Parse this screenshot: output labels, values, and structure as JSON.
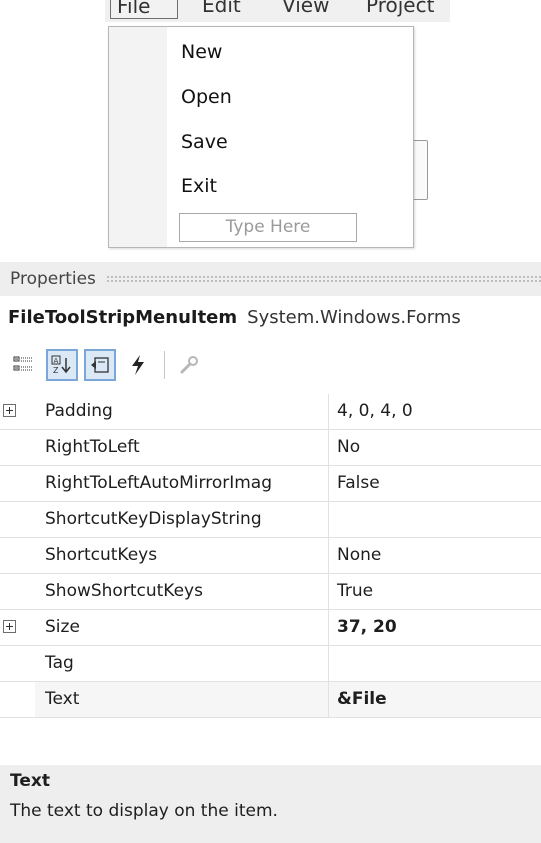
{
  "menubar": {
    "items": [
      "File",
      "Edit",
      "View",
      "Project"
    ]
  },
  "dropdown": {
    "items": [
      "New",
      "Open",
      "Save",
      "Exit"
    ],
    "type_here": "Type Here"
  },
  "properties": {
    "title": "Properties",
    "object_name": "FileToolStripMenuItem",
    "object_type": "System.Windows.Forms",
    "toolbar_icons": [
      "categorized-icon",
      "alphabetical-icon",
      "properties-icon",
      "events-icon",
      "property-pages-icon"
    ],
    "rows": [
      {
        "name": "Padding",
        "value": "4, 0, 4, 0",
        "expandable": true
      },
      {
        "name": "RightToLeft",
        "value": "No"
      },
      {
        "name": "RightToLeftAutoMirrorImag",
        "value": "False"
      },
      {
        "name": "ShortcutKeyDisplayString",
        "value": ""
      },
      {
        "name": "ShortcutKeys",
        "value": "None"
      },
      {
        "name": "ShowShortcutKeys",
        "value": "True"
      },
      {
        "name": "Size",
        "value": "37, 20",
        "expandable": true,
        "bold": true
      },
      {
        "name": "Tag",
        "value": ""
      },
      {
        "name": "Text",
        "value": "&File",
        "bold": true,
        "selected": true
      }
    ],
    "description": {
      "title": "Text",
      "text": "The text to display on the item."
    }
  },
  "colors": {
    "panel_bg": "#eeeeee",
    "active_button_border": "#7aa7d8",
    "lightning": "#222222"
  }
}
